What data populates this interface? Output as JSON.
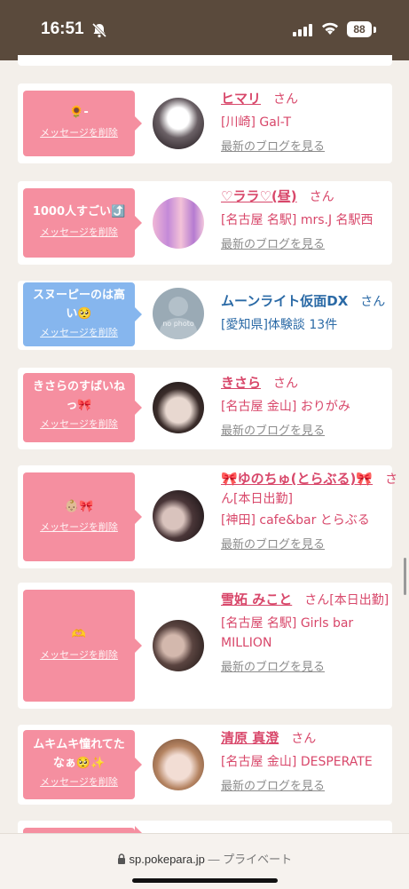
{
  "status": {
    "time": "16:51",
    "battery": "88"
  },
  "cards": [
    {
      "message": "🌻-",
      "delete": "メッセージを削除",
      "name": "ヒマリ",
      "san": "さん",
      "shop": "[川崎] Gal-T",
      "blog": "最新のブログを見る"
    },
    {
      "message": "1000人すごい⤴️",
      "delete": "メッセージを削除",
      "name": "♡ララ♡(昼)",
      "san": "さん",
      "shop": "[名古屋 名駅] mrs.J 名駅西",
      "blog": "最新のブログを見る"
    },
    {
      "message": "スヌーピーのは高い🥺",
      "delete": "メッセージを削除",
      "name": "ムーンライト仮面DX",
      "san": "さん",
      "shop": "[愛知県]体験談 13件",
      "avatar_text": "no photo"
    },
    {
      "message": "きさらのすばいねっ🎀",
      "delete": "メッセージを削除",
      "name": "きさら",
      "san": "さん",
      "shop": "[名古屋 金山] おりがみ",
      "blog": "最新のブログを見る"
    },
    {
      "message": "👶🏼🎀",
      "delete": "メッセージを削除",
      "name": "🎀ゆのちゅ(とらぶる)🎀",
      "san": "さん[本日出勤]",
      "shop": "[神田] cafe&bar とらぶる",
      "blog": "最新のブログを見る"
    },
    {
      "message": "🫶",
      "delete": "メッセージを削除",
      "name": "雪妬 みこと",
      "san": "さん[本日出勤]",
      "shop": "[名古屋 名駅] Girls bar MILLION",
      "blog": "最新のブログを見る"
    },
    {
      "message": "ムキムキ憧れてたなぁ🥺✨",
      "delete": "メッセージを削除",
      "name": "清原 真澄",
      "san": "さん",
      "shop": "[名古屋 金山] DESPERATE",
      "blog": "最新のブログを見る"
    }
  ],
  "browser": {
    "url": "sp.pokepara.jp",
    "separator": "—",
    "mode": "プライベート"
  },
  "colors": {
    "pink": "#f58fa0",
    "blue": "#86b6ee",
    "name_pink": "#d8476a",
    "name_blue": "#2b6aa6",
    "status_bg": "#5a4a3c"
  }
}
